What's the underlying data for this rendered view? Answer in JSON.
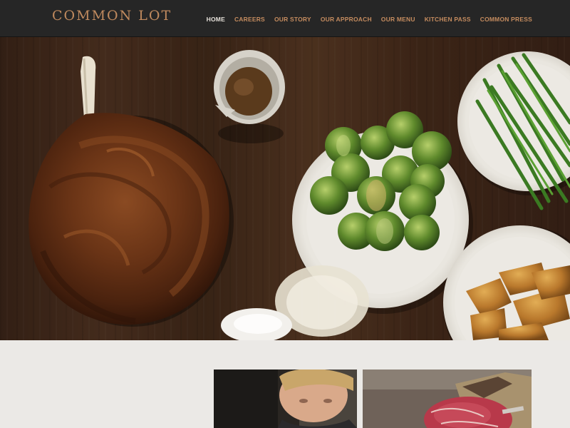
{
  "header": {
    "logo": "COMMON LOT",
    "nav": [
      {
        "label": "HOME",
        "active": true
      },
      {
        "label": "CAREERS",
        "active": false
      },
      {
        "label": "OUR STORY",
        "active": false
      },
      {
        "label": "OUR APPROACH",
        "active": false
      },
      {
        "label": "OUR MENU",
        "active": false
      },
      {
        "label": "KITCHEN PASS",
        "active": false
      },
      {
        "label": "COMMON PRESS",
        "active": false
      }
    ]
  },
  "colors": {
    "header_bg": "#262626",
    "accent": "#c58c5f",
    "nav_active": "#e6e1da",
    "page_bg": "#ebe9e6"
  },
  "hero": {
    "content": "food-photo"
  },
  "lower": {
    "cards": [
      {
        "content": "chef-photo"
      },
      {
        "content": "raw-steak-photo"
      }
    ]
  }
}
